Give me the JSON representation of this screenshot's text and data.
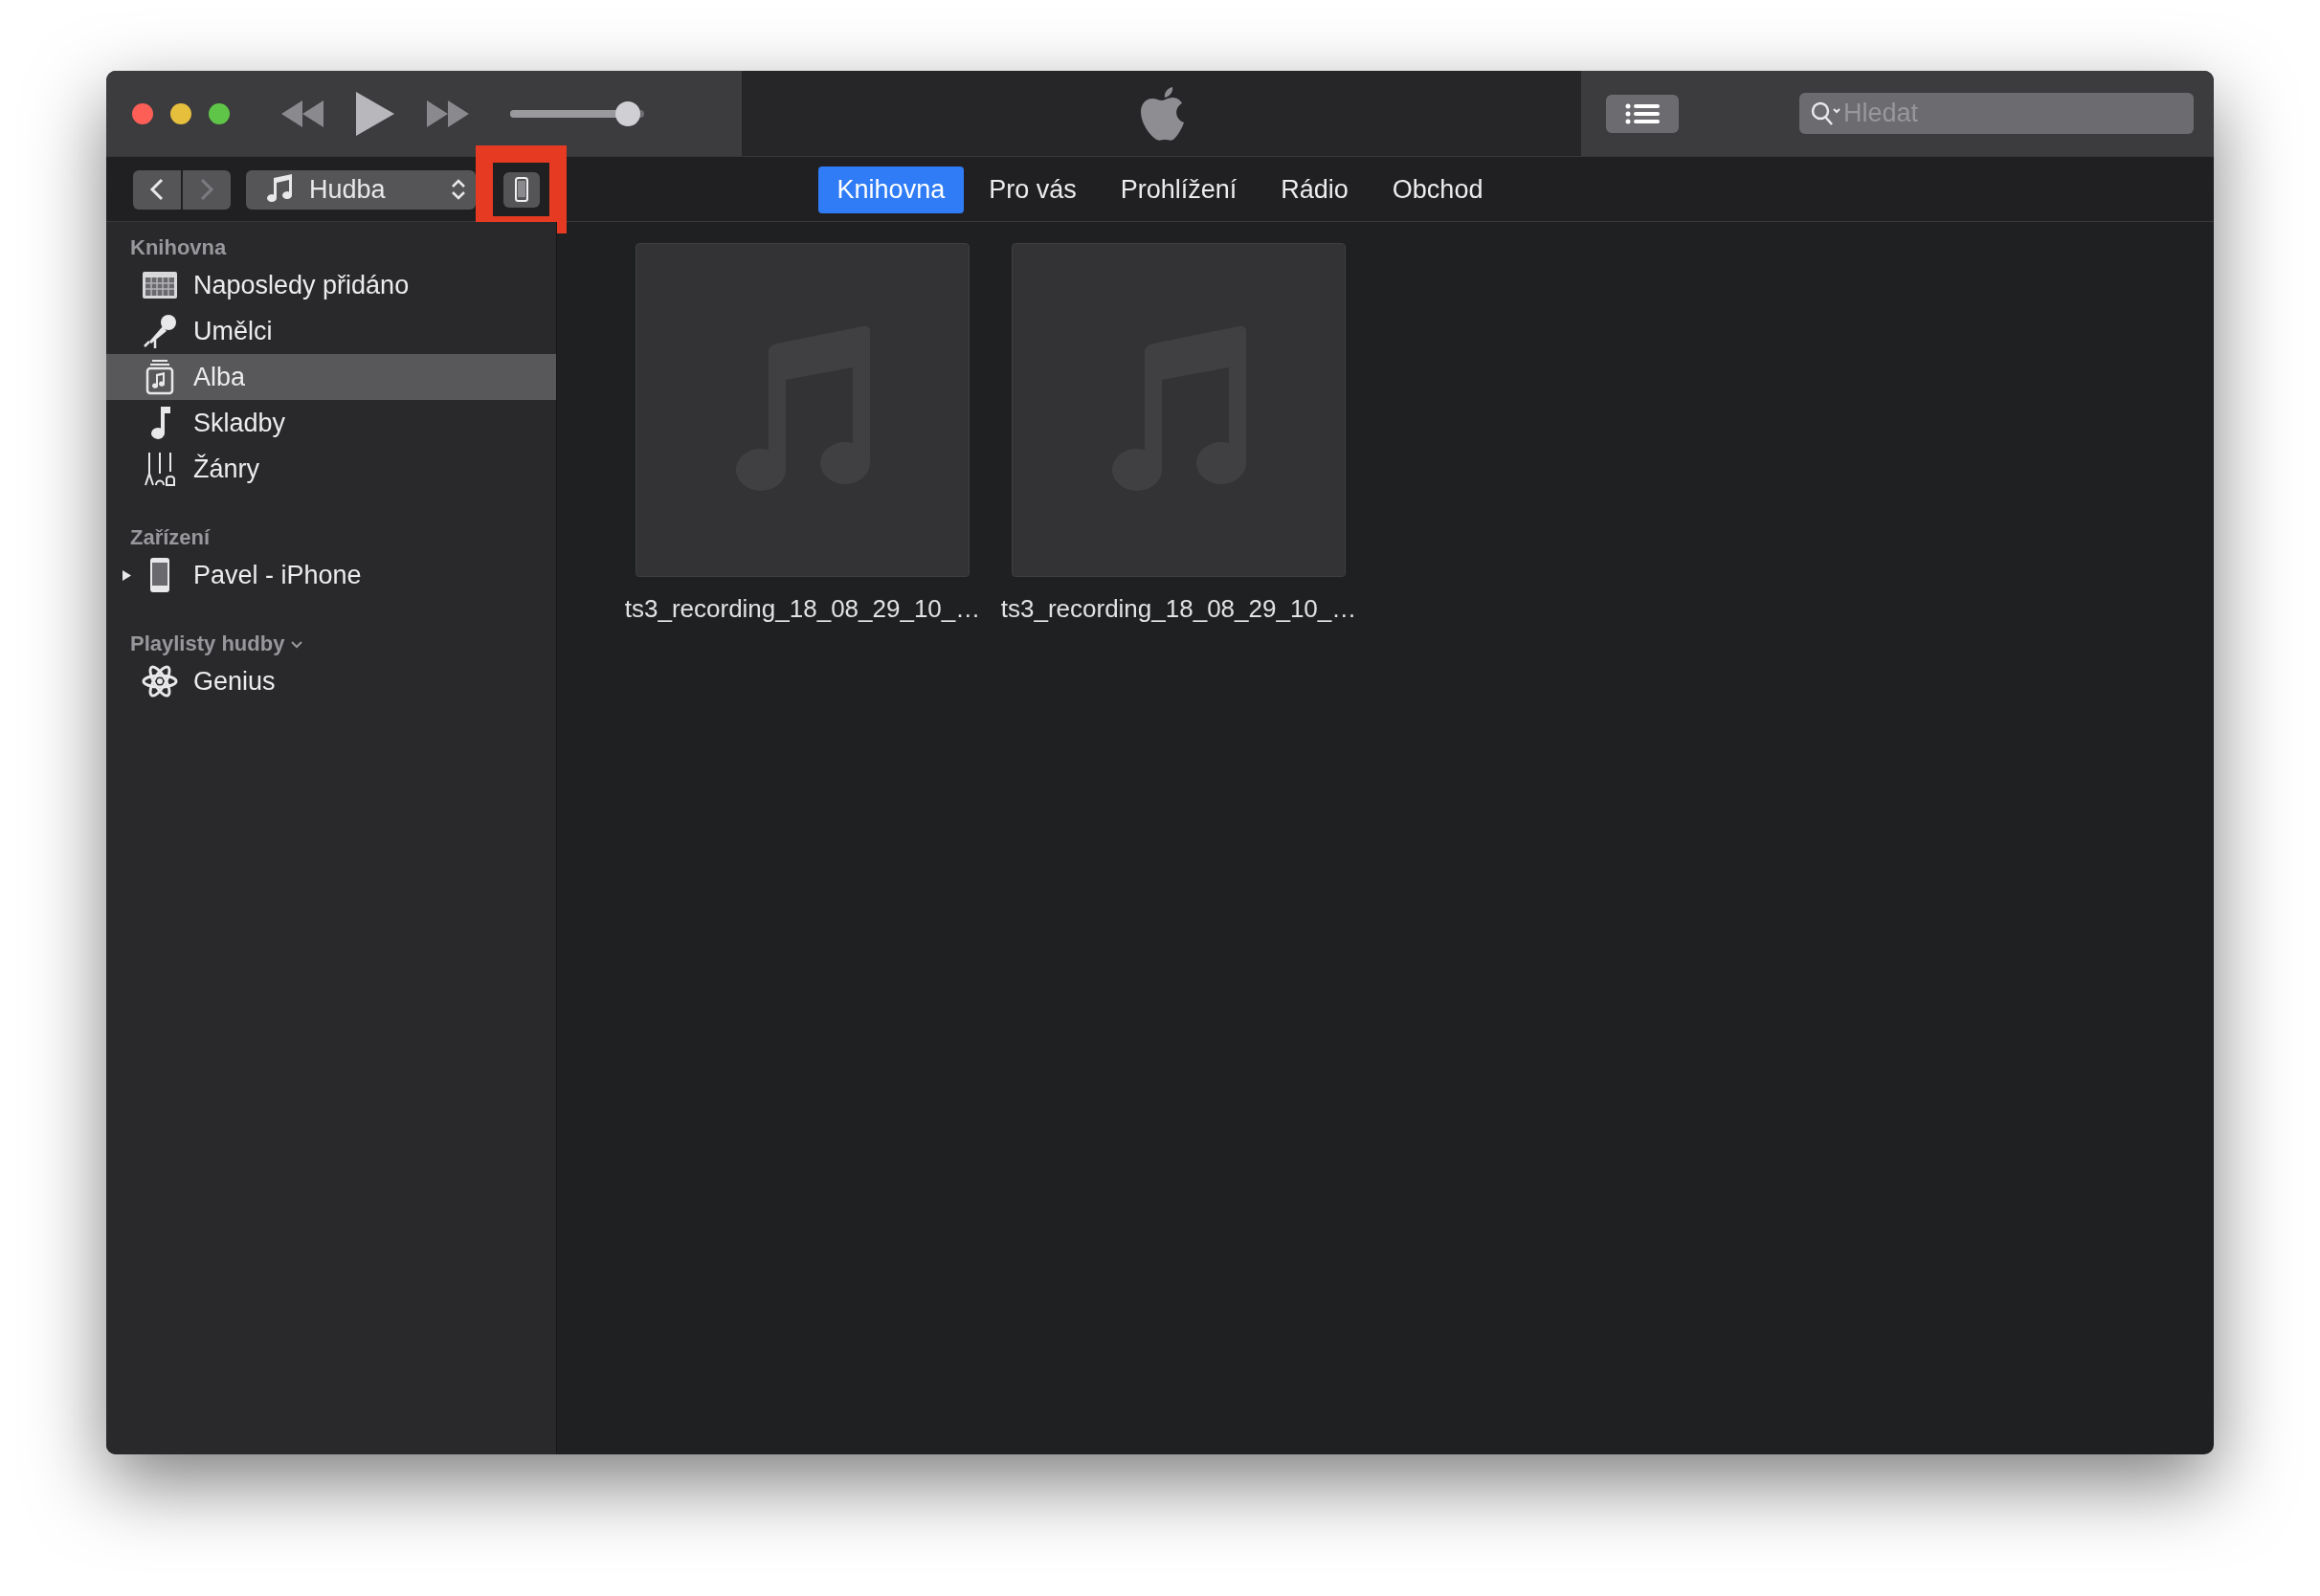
{
  "navigation": {
    "back": {
      "disabled": false
    },
    "forward": {
      "disabled": true
    }
  },
  "player": {
    "volume": {
      "level": 0.88
    }
  },
  "source_selector": {
    "label": "Hudba"
  },
  "device_button": {
    "highlighted": true
  },
  "search": {
    "placeholder": "Hledat"
  },
  "tabs": [
    {
      "label": "Knihovna",
      "selected": true
    },
    {
      "label": "Pro vás",
      "selected": false
    },
    {
      "label": "Prohlížení",
      "selected": false
    },
    {
      "label": "Rádio",
      "selected": false
    },
    {
      "label": "Obchod",
      "selected": false
    }
  ],
  "sidebar": {
    "sections": [
      {
        "title": "Knihovna",
        "items": [
          {
            "label": "Naposledy přidáno",
            "kind": "recent",
            "selected": false
          },
          {
            "label": "Umělci",
            "kind": "artists",
            "selected": false
          },
          {
            "label": "Alba",
            "kind": "albums",
            "selected": true
          },
          {
            "label": "Skladby",
            "kind": "songs",
            "selected": false
          },
          {
            "label": "Žánry",
            "kind": "genres",
            "selected": false
          }
        ]
      },
      {
        "title": "Zařízení",
        "items": [
          {
            "label": "Pavel - iPhone",
            "kind": "device",
            "selected": false,
            "expanded": false
          }
        ]
      },
      {
        "title": "Playlisty hudby",
        "has_menu": true,
        "items": [
          {
            "label": "Genius",
            "kind": "genius",
            "selected": false
          }
        ]
      }
    ]
  },
  "albums": [
    {
      "title": "ts3_recording_18_08_29_10_…"
    },
    {
      "title": "ts3_recording_18_08_29_10_…"
    }
  ]
}
